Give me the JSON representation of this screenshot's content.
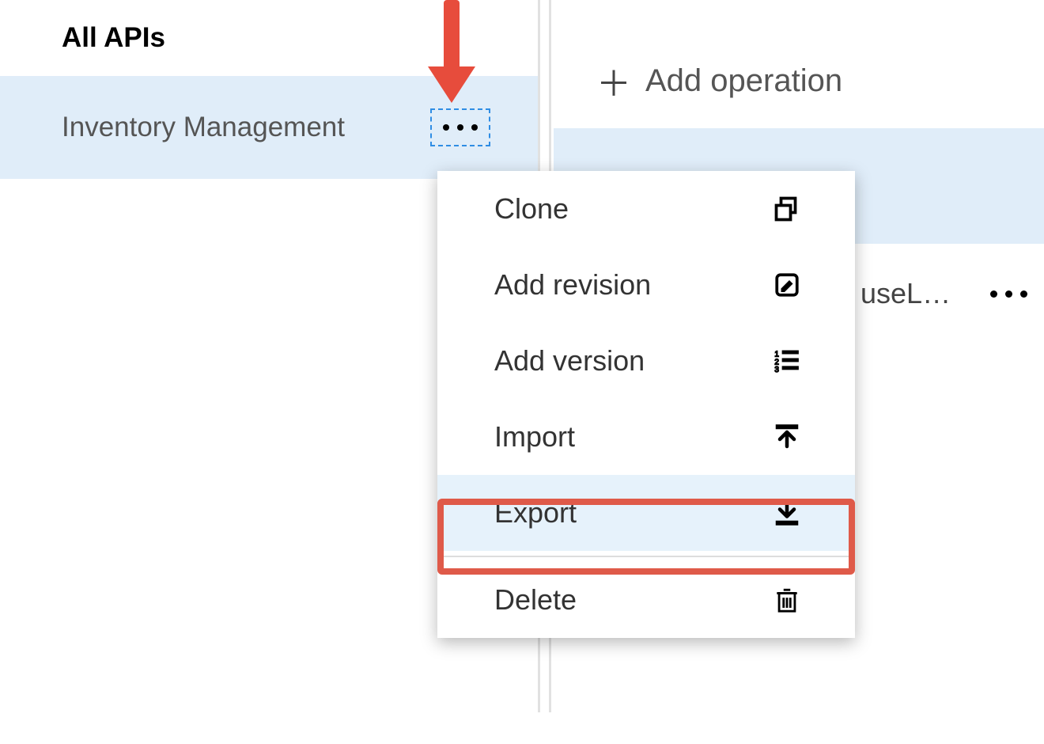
{
  "sidebar": {
    "all_apis_label": "All APIs",
    "selected_api": {
      "label": "Inventory Management"
    }
  },
  "right_panel": {
    "add_operation_label": "Add operation",
    "operation_row_text": "useL…"
  },
  "context_menu": {
    "items": [
      {
        "label": "Clone",
        "icon": "clone-icon"
      },
      {
        "label": "Add revision",
        "icon": "edit-icon"
      },
      {
        "label": "Add version",
        "icon": "numbered-list-icon"
      },
      {
        "label": "Import",
        "icon": "import-icon"
      },
      {
        "label": "Export",
        "icon": "export-icon",
        "hovered": true,
        "highlighted": true
      },
      {
        "label": "Delete",
        "icon": "delete-icon",
        "separated": true
      }
    ]
  },
  "annotations": {
    "arrow_color": "#e74c3c",
    "highlight_color": "#df5a49"
  }
}
